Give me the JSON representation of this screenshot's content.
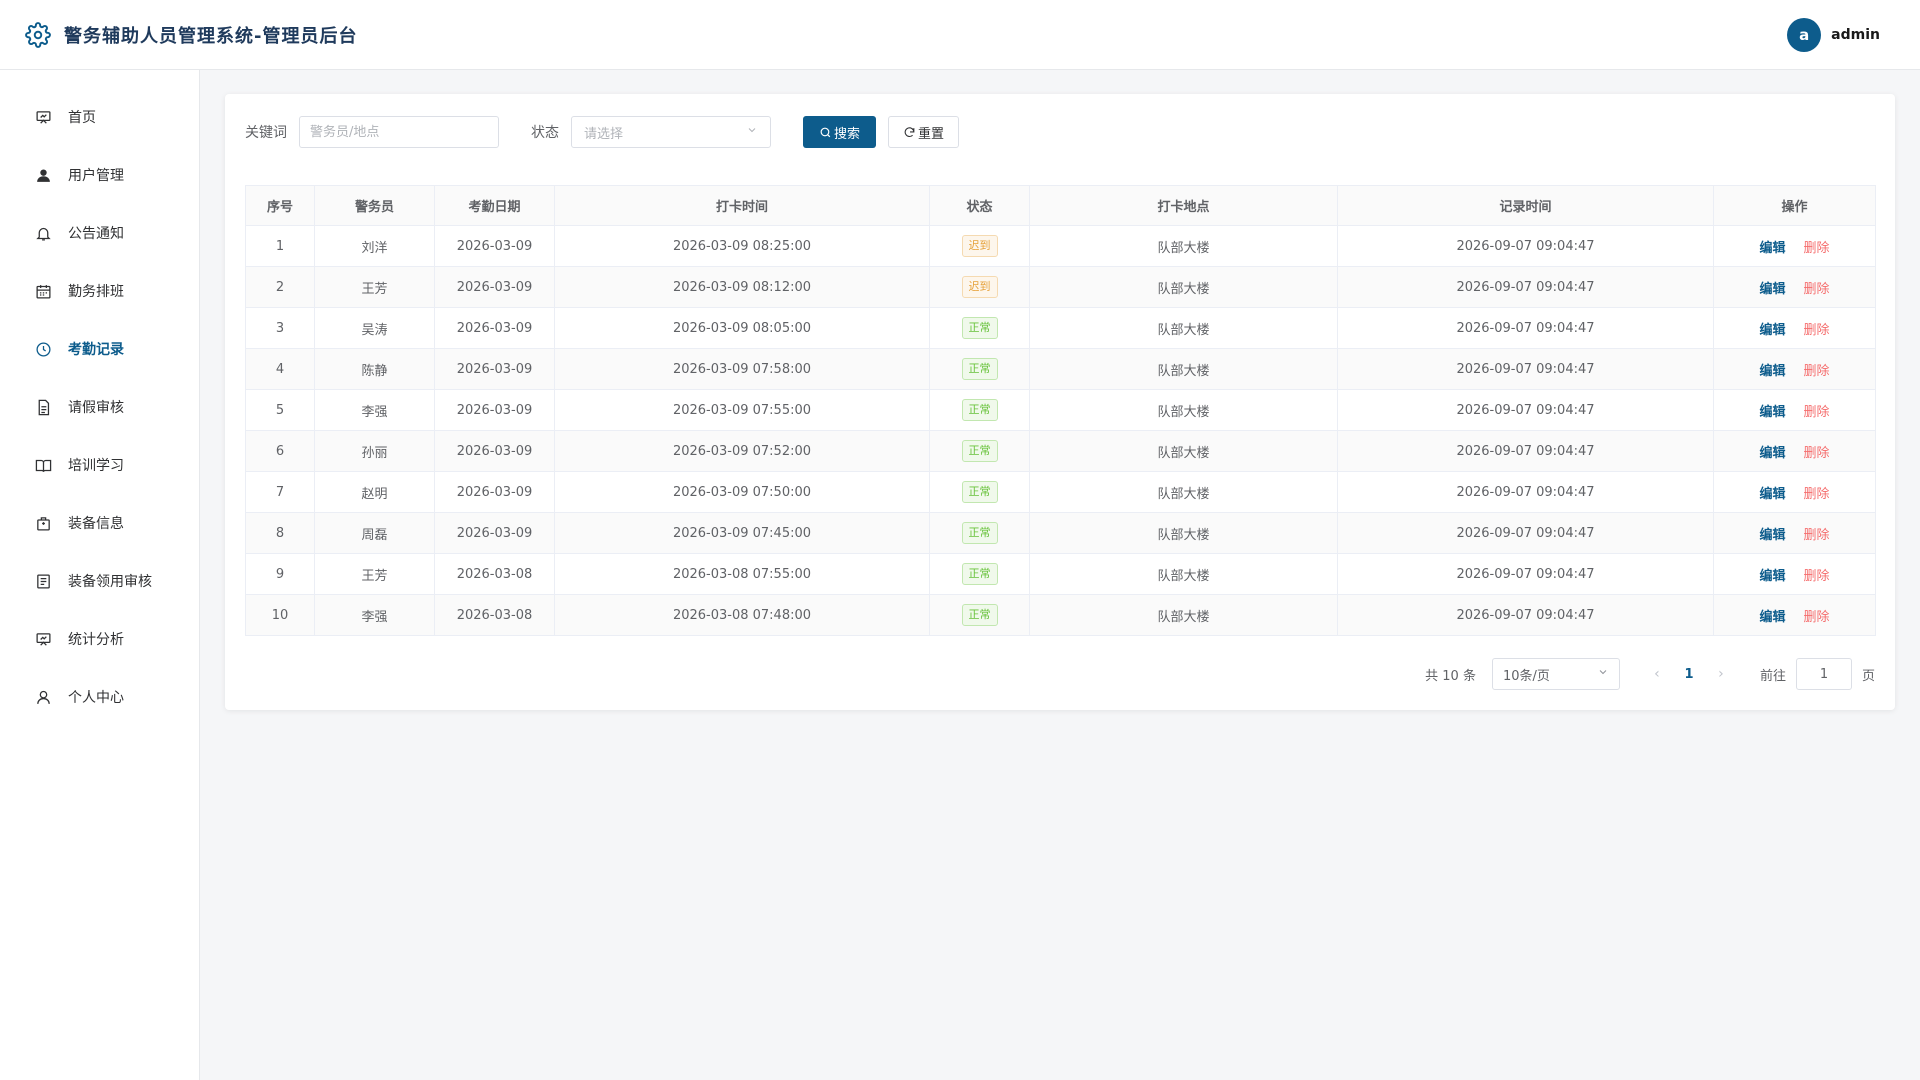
{
  "header": {
    "title": "警务辅助人员管理系统-管理员后台",
    "avatar_letter": "a",
    "username": "admin"
  },
  "sidebar": {
    "items": [
      {
        "label": "首页",
        "icon": "presentation-icon"
      },
      {
        "label": "用户管理",
        "icon": "user-icon"
      },
      {
        "label": "公告通知",
        "icon": "bell-icon"
      },
      {
        "label": "勤务排班",
        "icon": "calendar-icon"
      },
      {
        "label": "考勤记录",
        "icon": "clock-icon",
        "active": true
      },
      {
        "label": "请假审核",
        "icon": "document-icon"
      },
      {
        "label": "培训学习",
        "icon": "book-icon"
      },
      {
        "label": "装备信息",
        "icon": "bag-icon"
      },
      {
        "label": "装备领用审核",
        "icon": "list-icon"
      },
      {
        "label": "统计分析",
        "icon": "chart-icon"
      },
      {
        "label": "个人中心",
        "icon": "person-icon"
      }
    ]
  },
  "filters": {
    "keyword_label": "关键词",
    "keyword_placeholder": "警务员/地点",
    "status_label": "状态",
    "status_placeholder": "请选择",
    "search_label": "搜索",
    "reset_label": "重置"
  },
  "table": {
    "columns": [
      "序号",
      "警务员",
      "考勤日期",
      "打卡时间",
      "状态",
      "打卡地点",
      "记录时间",
      "操作"
    ],
    "edit_label": "编辑",
    "delete_label": "删除",
    "rows": [
      {
        "no": "1",
        "name": "刘洋",
        "date": "2026-03-09",
        "time": "2026-03-09 08:25:00",
        "status": "迟到",
        "status_type": "late",
        "place": "队部大楼",
        "recorded": "2026-09-07 09:04:47"
      },
      {
        "no": "2",
        "name": "王芳",
        "date": "2026-03-09",
        "time": "2026-03-09 08:12:00",
        "status": "迟到",
        "status_type": "late",
        "place": "队部大楼",
        "recorded": "2026-09-07 09:04:47"
      },
      {
        "no": "3",
        "name": "吴涛",
        "date": "2026-03-09",
        "time": "2026-03-09 08:05:00",
        "status": "正常",
        "status_type": "ok",
        "place": "队部大楼",
        "recorded": "2026-09-07 09:04:47"
      },
      {
        "no": "4",
        "name": "陈静",
        "date": "2026-03-09",
        "time": "2026-03-09 07:58:00",
        "status": "正常",
        "status_type": "ok",
        "place": "队部大楼",
        "recorded": "2026-09-07 09:04:47"
      },
      {
        "no": "5",
        "name": "李强",
        "date": "2026-03-09",
        "time": "2026-03-09 07:55:00",
        "status": "正常",
        "status_type": "ok",
        "place": "队部大楼",
        "recorded": "2026-09-07 09:04:47"
      },
      {
        "no": "6",
        "name": "孙丽",
        "date": "2026-03-09",
        "time": "2026-03-09 07:52:00",
        "status": "正常",
        "status_type": "ok",
        "place": "队部大楼",
        "recorded": "2026-09-07 09:04:47"
      },
      {
        "no": "7",
        "name": "赵明",
        "date": "2026-03-09",
        "time": "2026-03-09 07:50:00",
        "status": "正常",
        "status_type": "ok",
        "place": "队部大楼",
        "recorded": "2026-09-07 09:04:47"
      },
      {
        "no": "8",
        "name": "周磊",
        "date": "2026-03-09",
        "time": "2026-03-09 07:45:00",
        "status": "正常",
        "status_type": "ok",
        "place": "队部大楼",
        "recorded": "2026-09-07 09:04:47"
      },
      {
        "no": "9",
        "name": "王芳",
        "date": "2026-03-08",
        "time": "2026-03-08 07:55:00",
        "status": "正常",
        "status_type": "ok",
        "place": "队部大楼",
        "recorded": "2026-09-07 09:04:47"
      },
      {
        "no": "10",
        "name": "李强",
        "date": "2026-03-08",
        "time": "2026-03-08 07:48:00",
        "status": "正常",
        "status_type": "ok",
        "place": "队部大楼",
        "recorded": "2026-09-07 09:04:47"
      }
    ]
  },
  "pagination": {
    "total_text": "共 10 条",
    "page_size": "10条/页",
    "prev": "‹",
    "next": "›",
    "current_page": "1",
    "goto_label": "前往",
    "goto_value": "1",
    "page_suffix": "页"
  },
  "colors": {
    "accent": "#0d5c8c",
    "danger": "#f56c6c",
    "warning": "#e6a23c",
    "success": "#67c23a"
  }
}
